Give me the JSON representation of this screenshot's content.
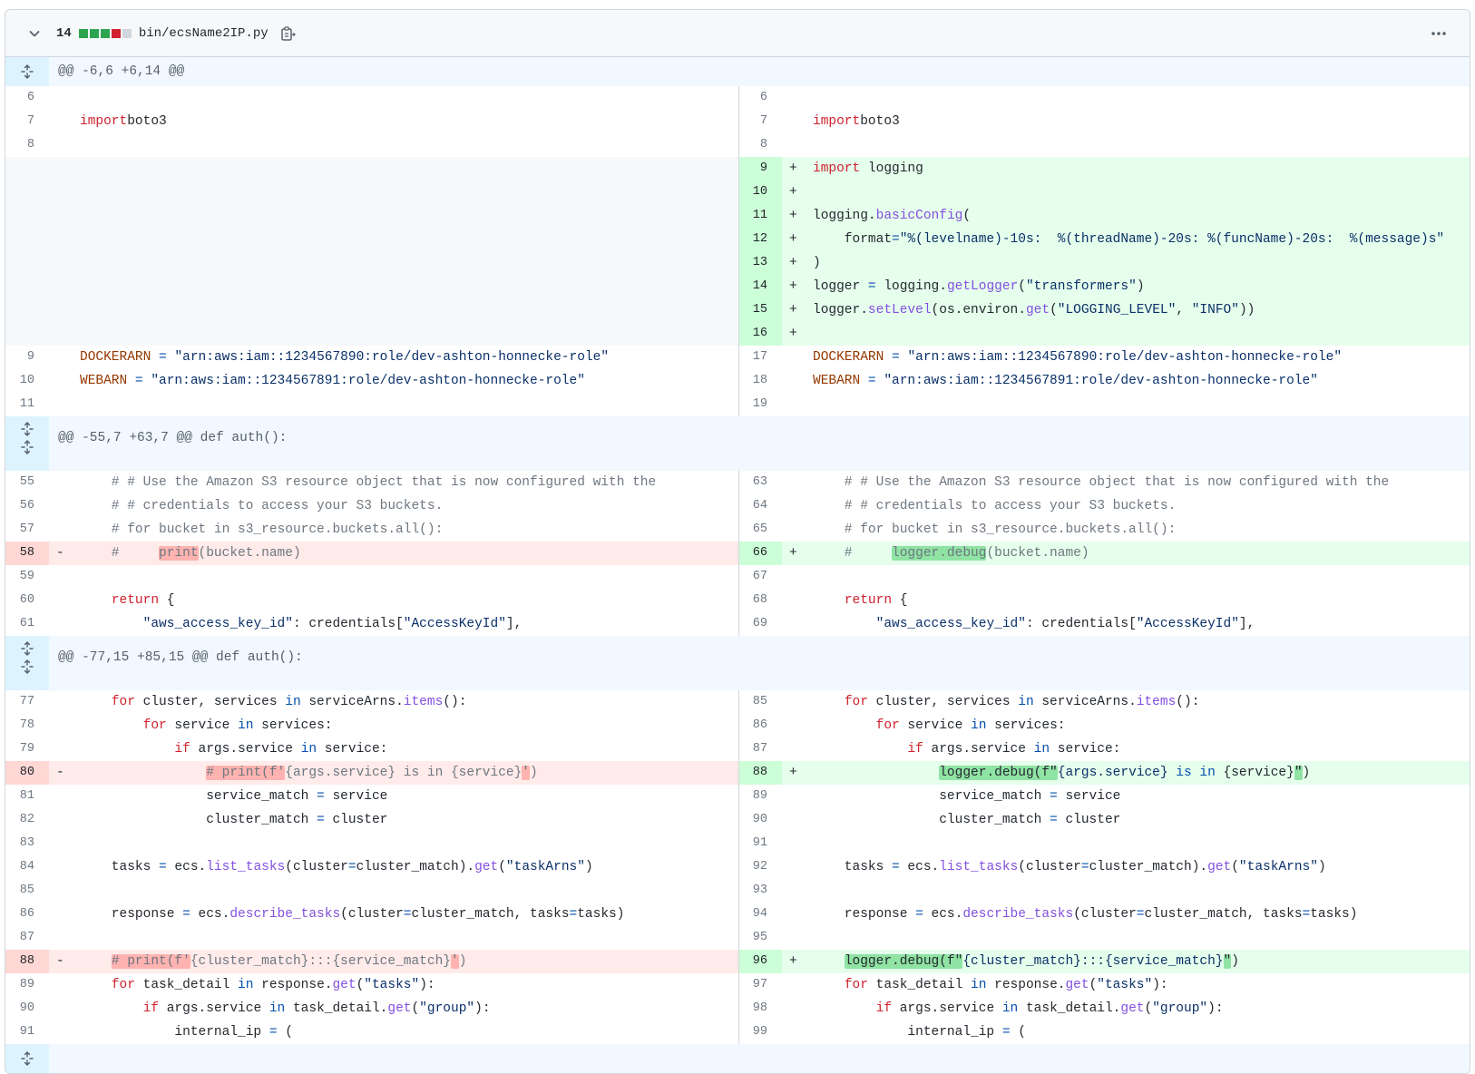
{
  "file": {
    "additions_count": "14",
    "path": "bin/ecsName2IP.py",
    "diffstat": [
      "add",
      "add",
      "add",
      "del",
      "neutral"
    ],
    "colors": {
      "add": "#2da44e",
      "del": "#cf222e",
      "neutral": "#d0d7de"
    },
    "icons": {
      "collapse": "chevron-down-icon",
      "copy": "copy-icon",
      "menu": "kebab-horizontal-icon",
      "expand": "unfold-icon"
    }
  },
  "rows": [
    {
      "t": "hunk",
      "text": "@@ -6,6 +6,14 @@",
      "icons": 1
    },
    {
      "t": "ctx",
      "ln": "6",
      "rn": "6",
      "code": []
    },
    {
      "t": "ctx",
      "ln": "7",
      "rn": "7",
      "code": [
        [
          "k",
          "import"
        ],
        [
          "",
          "boto3"
        ]
      ],
      "sp": [
        " "
      ]
    },
    {
      "t": "ctx",
      "ln": "8",
      "rn": "8",
      "code": []
    },
    {
      "t": "add",
      "rn": "9",
      "code": [
        [
          "k",
          "import"
        ],
        [
          "",
          " logging"
        ]
      ]
    },
    {
      "t": "add",
      "rn": "10",
      "code": []
    },
    {
      "t": "add",
      "rn": "11",
      "code": [
        [
          "",
          "logging."
        ],
        [
          "f",
          "basicConfig"
        ],
        [
          "",
          "("
        ]
      ]
    },
    {
      "t": "add",
      "rn": "12",
      "code": [
        [
          "",
          "    format"
        ],
        [
          "o",
          "="
        ],
        [
          "s",
          "\"%(levelname)-10s:  %(threadName)-20s: %(funcName)-20s:  %(message)s\""
        ]
      ]
    },
    {
      "t": "add",
      "rn": "13",
      "code": [
        [
          "",
          ")"
        ]
      ]
    },
    {
      "t": "add",
      "rn": "14",
      "code": [
        [
          "",
          "logger "
        ],
        [
          "o",
          "="
        ],
        [
          "",
          " logging."
        ],
        [
          "f",
          "getLogger"
        ],
        [
          "",
          "("
        ],
        [
          "s",
          "\"transformers\""
        ],
        [
          "",
          ")"
        ]
      ]
    },
    {
      "t": "add",
      "rn": "15",
      "code": [
        [
          "",
          "logger."
        ],
        [
          "f",
          "setLevel"
        ],
        [
          "",
          "(os.environ."
        ],
        [
          "f",
          "get"
        ],
        [
          "",
          "("
        ],
        [
          "s",
          "\"LOGGING_LEVEL\""
        ],
        [
          "",
          ", "
        ],
        [
          "s",
          "\"INFO\""
        ],
        [
          "",
          "))"
        ]
      ]
    },
    {
      "t": "add",
      "rn": "16",
      "code": []
    },
    {
      "t": "ctx",
      "ln": "9",
      "rn": "17",
      "code": [
        [
          "v",
          "DOCKERARN"
        ],
        [
          "",
          " "
        ],
        [
          "o",
          "="
        ],
        [
          "",
          " "
        ],
        [
          "s",
          "\"arn:aws:iam::1234567890:role/dev-ashton-honnecke-role\""
        ]
      ]
    },
    {
      "t": "ctx",
      "ln": "10",
      "rn": "18",
      "code": [
        [
          "v",
          "WEBARN"
        ],
        [
          "",
          " "
        ],
        [
          "o",
          "="
        ],
        [
          "",
          " "
        ],
        [
          "s",
          "\"arn:aws:iam::1234567891:role/dev-ashton-honnecke-role\""
        ]
      ]
    },
    {
      "t": "ctx",
      "ln": "11",
      "rn": "19",
      "code": []
    },
    {
      "t": "hunk",
      "text": "@@ -55,7 +63,7 @@ def auth():",
      "icons": 2
    },
    {
      "t": "ctx",
      "ln": "55",
      "rn": "63",
      "code": [
        [
          "c",
          "    # # Use the Amazon S3 resource object that is now configured with the"
        ]
      ]
    },
    {
      "t": "ctx",
      "ln": "56",
      "rn": "64",
      "code": [
        [
          "c",
          "    # # credentials to access your S3 buckets."
        ]
      ]
    },
    {
      "t": "ctx",
      "ln": "57",
      "rn": "65",
      "code": [
        [
          "c",
          "    # for bucket in s3_resource.buckets.all():"
        ]
      ]
    },
    {
      "t": "chg",
      "ln": "58",
      "rn": "66",
      "lcode": [
        [
          "c",
          "    #     "
        ],
        [
          "c hl-del",
          "print"
        ],
        [
          "c",
          "(bucket.name)"
        ]
      ],
      "rcode": [
        [
          "c",
          "    #     "
        ],
        [
          "c hl-add",
          "logger.debug"
        ],
        [
          "c",
          "(bucket.name)"
        ]
      ]
    },
    {
      "t": "ctx",
      "ln": "59",
      "rn": "67",
      "code": []
    },
    {
      "t": "ctx",
      "ln": "60",
      "rn": "68",
      "code": [
        [
          "",
          "    "
        ],
        [
          "k",
          "return"
        ],
        [
          "",
          " {"
        ]
      ]
    },
    {
      "t": "ctx",
      "ln": "61",
      "rn": "69",
      "code": [
        [
          "",
          "        "
        ],
        [
          "s",
          "\"aws_access_key_id\""
        ],
        [
          "",
          ": credentials["
        ],
        [
          "s",
          "\"AccessKeyId\""
        ],
        [
          "",
          "],"
        ]
      ]
    },
    {
      "t": "hunk",
      "text": "@@ -77,15 +85,15 @@ def auth():",
      "icons": 3
    },
    {
      "t": "ctx",
      "ln": "77",
      "rn": "85",
      "code": [
        [
          "",
          "    "
        ],
        [
          "k",
          "for"
        ],
        [
          "",
          " cluster, services "
        ],
        [
          "o",
          "in"
        ],
        [
          "",
          " serviceArns."
        ],
        [
          "f",
          "items"
        ],
        [
          "",
          "():"
        ]
      ]
    },
    {
      "t": "ctx",
      "ln": "78",
      "rn": "86",
      "code": [
        [
          "",
          "        "
        ],
        [
          "k",
          "for"
        ],
        [
          "",
          " service "
        ],
        [
          "o",
          "in"
        ],
        [
          "",
          " services:"
        ]
      ]
    },
    {
      "t": "ctx",
      "ln": "79",
      "rn": "87",
      "code": [
        [
          "",
          "            "
        ],
        [
          "k",
          "if"
        ],
        [
          "",
          " args.service "
        ],
        [
          "o",
          "in"
        ],
        [
          "",
          " service:"
        ]
      ]
    },
    {
      "t": "chg",
      "ln": "80",
      "rn": "88",
      "lcode": [
        [
          "",
          "                "
        ],
        [
          "c hl-del",
          "# print(f'"
        ],
        [
          "c",
          "{args.service} is in {service}"
        ],
        [
          "c hl-del",
          "'"
        ],
        [
          "c",
          ")"
        ]
      ],
      "rcode": [
        [
          "",
          "                "
        ],
        [
          "hl-add",
          "logger.debug(f\""
        ],
        [
          "s",
          "{args.service} "
        ],
        [
          "o",
          "is"
        ],
        [
          "",
          " "
        ],
        [
          "o",
          "in"
        ],
        [
          "",
          " {service}"
        ],
        [
          "hl-add",
          "\""
        ],
        [
          "",
          ")"
        ]
      ]
    },
    {
      "t": "ctx",
      "ln": "81",
      "rn": "89",
      "code": [
        [
          "",
          "                service_match "
        ],
        [
          "o",
          "="
        ],
        [
          "",
          " service"
        ]
      ]
    },
    {
      "t": "ctx",
      "ln": "82",
      "rn": "90",
      "code": [
        [
          "",
          "                cluster_match "
        ],
        [
          "o",
          "="
        ],
        [
          "",
          " cluster"
        ]
      ]
    },
    {
      "t": "ctx",
      "ln": "83",
      "rn": "91",
      "code": []
    },
    {
      "t": "ctx",
      "ln": "84",
      "rn": "92",
      "code": [
        [
          "",
          "    tasks "
        ],
        [
          "o",
          "="
        ],
        [
          "",
          " ecs."
        ],
        [
          "f",
          "list_tasks"
        ],
        [
          "",
          "(cluster"
        ],
        [
          "o",
          "="
        ],
        [
          "",
          "cluster_match)."
        ],
        [
          "f",
          "get"
        ],
        [
          "",
          "("
        ],
        [
          "s",
          "\"taskArns\""
        ],
        [
          "",
          ")"
        ]
      ]
    },
    {
      "t": "ctx",
      "ln": "85",
      "rn": "93",
      "code": []
    },
    {
      "t": "ctx",
      "ln": "86",
      "rn": "94",
      "code": [
        [
          "",
          "    response "
        ],
        [
          "o",
          "="
        ],
        [
          "",
          " ecs."
        ],
        [
          "f",
          "describe_tasks"
        ],
        [
          "",
          "(cluster"
        ],
        [
          "o",
          "="
        ],
        [
          "",
          "cluster_match, tasks"
        ],
        [
          "o",
          "="
        ],
        [
          "",
          "tasks)"
        ]
      ]
    },
    {
      "t": "ctx",
      "ln": "87",
      "rn": "95",
      "code": []
    },
    {
      "t": "chg",
      "ln": "88",
      "rn": "96",
      "lcode": [
        [
          "",
          "    "
        ],
        [
          "c hl-del",
          "# print(f'"
        ],
        [
          "c",
          "{cluster_match}:::{service_match}"
        ],
        [
          "c hl-del",
          "'"
        ],
        [
          "c",
          ")"
        ]
      ],
      "rcode": [
        [
          "",
          "    "
        ],
        [
          "hl-add",
          "logger.debug(f\""
        ],
        [
          "s",
          "{cluster_match}:::{service_match}"
        ],
        [
          "hl-add",
          "\""
        ],
        [
          "",
          ")"
        ]
      ]
    },
    {
      "t": "ctx",
      "ln": "89",
      "rn": "97",
      "code": [
        [
          "",
          "    "
        ],
        [
          "k",
          "for"
        ],
        [
          "",
          " task_detail "
        ],
        [
          "o",
          "in"
        ],
        [
          "",
          " response."
        ],
        [
          "f",
          "get"
        ],
        [
          "",
          "("
        ],
        [
          "s",
          "\"tasks\""
        ],
        [
          "",
          "):"
        ]
      ]
    },
    {
      "t": "ctx",
      "ln": "90",
      "rn": "98",
      "code": [
        [
          "",
          "        "
        ],
        [
          "k",
          "if"
        ],
        [
          "",
          " args.service "
        ],
        [
          "o",
          "in"
        ],
        [
          "",
          " task_detail."
        ],
        [
          "f",
          "get"
        ],
        [
          "",
          "("
        ],
        [
          "s",
          "\"group\""
        ],
        [
          "",
          "):"
        ]
      ]
    },
    {
      "t": "ctx",
      "ln": "91",
      "rn": "99",
      "code": [
        [
          "",
          "            internal_ip "
        ],
        [
          "o",
          "="
        ],
        [
          "",
          " ("
        ]
      ]
    },
    {
      "t": "hunk",
      "text": "",
      "icons": 1
    }
  ]
}
